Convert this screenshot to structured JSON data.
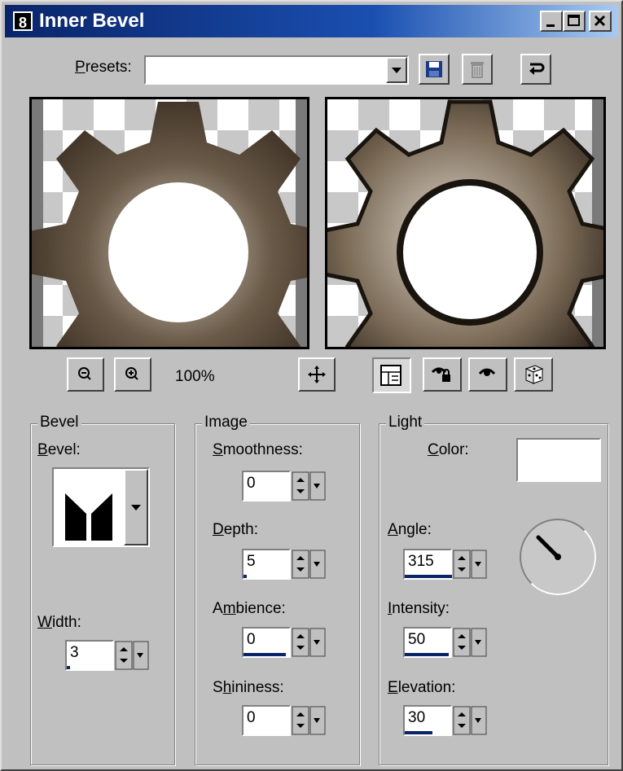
{
  "window": {
    "icon_text": "8",
    "title": "Inner Bevel"
  },
  "presets": {
    "label": "Presets:",
    "value": ""
  },
  "preview": {
    "zoom": "100%"
  },
  "bevel": {
    "group_title": "Bevel",
    "bevel_label": "Bevel:",
    "width_label": "Width:",
    "width": "3"
  },
  "image": {
    "group_title": "Image",
    "smoothness_label": "Smoothness:",
    "smoothness": "0",
    "depth_label": "Depth:",
    "depth": "5",
    "ambience_label": "Ambience:",
    "ambience": "0",
    "shininess_label": "Shininess:",
    "shininess": "0"
  },
  "light": {
    "group_title": "Light",
    "color_label": "Color:",
    "color": "#ffffff",
    "angle_label": "Angle:",
    "angle": "315",
    "intensity_label": "Intensity:",
    "intensity": "50",
    "elevation_label": "Elevation:",
    "elevation": "30"
  },
  "icons": [
    "app-icon",
    "minimize-icon",
    "maximize-icon",
    "close-icon",
    "save-preset-icon",
    "delete-preset-icon",
    "reset-icon",
    "zoom-out-icon",
    "zoom-in-icon",
    "pan-icon",
    "proof-icon",
    "lock-icon",
    "eye-icon",
    "randomize-dice-icon"
  ]
}
